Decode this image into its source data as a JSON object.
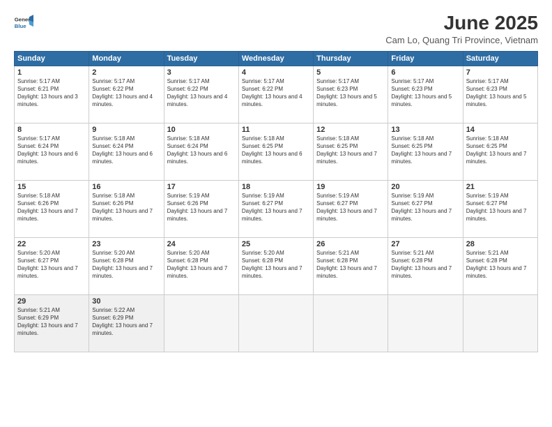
{
  "logo": {
    "general": "General",
    "blue": "Blue"
  },
  "header": {
    "month": "June 2025",
    "location": "Cam Lo, Quang Tri Province, Vietnam"
  },
  "weekdays": [
    "Sunday",
    "Monday",
    "Tuesday",
    "Wednesday",
    "Thursday",
    "Friday",
    "Saturday"
  ],
  "weeks": [
    [
      {
        "day": "1",
        "sunrise": "5:17 AM",
        "sunset": "6:21 PM",
        "daylight": "13 hours and 3 minutes."
      },
      {
        "day": "2",
        "sunrise": "5:17 AM",
        "sunset": "6:22 PM",
        "daylight": "13 hours and 4 minutes."
      },
      {
        "day": "3",
        "sunrise": "5:17 AM",
        "sunset": "6:22 PM",
        "daylight": "13 hours and 4 minutes."
      },
      {
        "day": "4",
        "sunrise": "5:17 AM",
        "sunset": "6:22 PM",
        "daylight": "13 hours and 4 minutes."
      },
      {
        "day": "5",
        "sunrise": "5:17 AM",
        "sunset": "6:23 PM",
        "daylight": "13 hours and 5 minutes."
      },
      {
        "day": "6",
        "sunrise": "5:17 AM",
        "sunset": "6:23 PM",
        "daylight": "13 hours and 5 minutes."
      },
      {
        "day": "7",
        "sunrise": "5:17 AM",
        "sunset": "6:23 PM",
        "daylight": "13 hours and 5 minutes."
      }
    ],
    [
      {
        "day": "8",
        "sunrise": "5:17 AM",
        "sunset": "6:24 PM",
        "daylight": "13 hours and 6 minutes."
      },
      {
        "day": "9",
        "sunrise": "5:18 AM",
        "sunset": "6:24 PM",
        "daylight": "13 hours and 6 minutes."
      },
      {
        "day": "10",
        "sunrise": "5:18 AM",
        "sunset": "6:24 PM",
        "daylight": "13 hours and 6 minutes."
      },
      {
        "day": "11",
        "sunrise": "5:18 AM",
        "sunset": "6:25 PM",
        "daylight": "13 hours and 6 minutes."
      },
      {
        "day": "12",
        "sunrise": "5:18 AM",
        "sunset": "6:25 PM",
        "daylight": "13 hours and 7 minutes."
      },
      {
        "day": "13",
        "sunrise": "5:18 AM",
        "sunset": "6:25 PM",
        "daylight": "13 hours and 7 minutes."
      },
      {
        "day": "14",
        "sunrise": "5:18 AM",
        "sunset": "6:25 PM",
        "daylight": "13 hours and 7 minutes."
      }
    ],
    [
      {
        "day": "15",
        "sunrise": "5:18 AM",
        "sunset": "6:26 PM",
        "daylight": "13 hours and 7 minutes."
      },
      {
        "day": "16",
        "sunrise": "5:18 AM",
        "sunset": "6:26 PM",
        "daylight": "13 hours and 7 minutes."
      },
      {
        "day": "17",
        "sunrise": "5:19 AM",
        "sunset": "6:26 PM",
        "daylight": "13 hours and 7 minutes."
      },
      {
        "day": "18",
        "sunrise": "5:19 AM",
        "sunset": "6:27 PM",
        "daylight": "13 hours and 7 minutes."
      },
      {
        "day": "19",
        "sunrise": "5:19 AM",
        "sunset": "6:27 PM",
        "daylight": "13 hours and 7 minutes."
      },
      {
        "day": "20",
        "sunrise": "5:19 AM",
        "sunset": "6:27 PM",
        "daylight": "13 hours and 7 minutes."
      },
      {
        "day": "21",
        "sunrise": "5:19 AM",
        "sunset": "6:27 PM",
        "daylight": "13 hours and 7 minutes."
      }
    ],
    [
      {
        "day": "22",
        "sunrise": "5:20 AM",
        "sunset": "6:27 PM",
        "daylight": "13 hours and 7 minutes."
      },
      {
        "day": "23",
        "sunrise": "5:20 AM",
        "sunset": "6:28 PM",
        "daylight": "13 hours and 7 minutes."
      },
      {
        "day": "24",
        "sunrise": "5:20 AM",
        "sunset": "6:28 PM",
        "daylight": "13 hours and 7 minutes."
      },
      {
        "day": "25",
        "sunrise": "5:20 AM",
        "sunset": "6:28 PM",
        "daylight": "13 hours and 7 minutes."
      },
      {
        "day": "26",
        "sunrise": "5:21 AM",
        "sunset": "6:28 PM",
        "daylight": "13 hours and 7 minutes."
      },
      {
        "day": "27",
        "sunrise": "5:21 AM",
        "sunset": "6:28 PM",
        "daylight": "13 hours and 7 minutes."
      },
      {
        "day": "28",
        "sunrise": "5:21 AM",
        "sunset": "6:28 PM",
        "daylight": "13 hours and 7 minutes."
      }
    ],
    [
      {
        "day": "29",
        "sunrise": "5:21 AM",
        "sunset": "6:29 PM",
        "daylight": "13 hours and 7 minutes."
      },
      {
        "day": "30",
        "sunrise": "5:22 AM",
        "sunset": "6:29 PM",
        "daylight": "13 hours and 7 minutes."
      },
      null,
      null,
      null,
      null,
      null
    ]
  ],
  "labels": {
    "sunrise": "Sunrise:",
    "sunset": "Sunset:",
    "daylight": "Daylight:"
  }
}
